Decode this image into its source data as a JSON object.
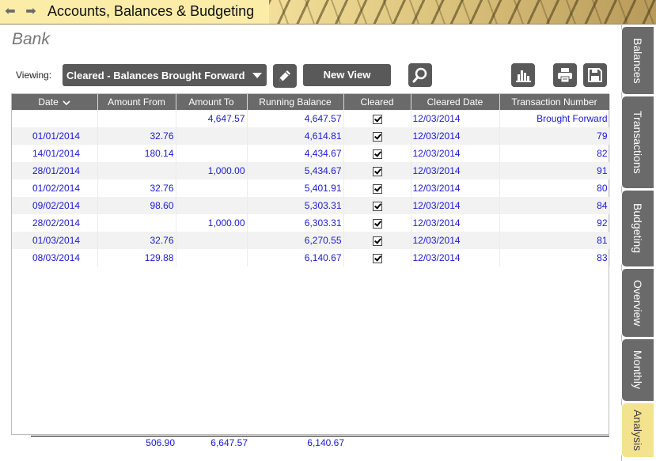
{
  "titlebar": {
    "title": "Accounts, Balances & Budgeting",
    "back_icon": "arrow-left-icon",
    "forward_icon": "arrow-right-icon"
  },
  "page": {
    "title": "Bank"
  },
  "toolbar": {
    "viewing_label": "Viewing:",
    "view_selected": "Cleared - Balances Brought Forward",
    "new_view_label": "New View"
  },
  "table": {
    "columns": [
      "Date",
      "Amount From",
      "Amount To",
      "Running Balance",
      "Cleared",
      "Cleared Date",
      "Transaction Number"
    ],
    "rows": [
      {
        "date": "",
        "from": "",
        "to": "4,647.57",
        "balance": "4,647.57",
        "cleared": true,
        "cleared_date": "12/03/2014",
        "txn": "Brought Forward"
      },
      {
        "date": "01/01/2014",
        "from": "32.76",
        "to": "",
        "balance": "4,614.81",
        "cleared": true,
        "cleared_date": "12/03/2014",
        "txn": "79"
      },
      {
        "date": "14/01/2014",
        "from": "180.14",
        "to": "",
        "balance": "4,434.67",
        "cleared": true,
        "cleared_date": "12/03/2014",
        "txn": "82"
      },
      {
        "date": "28/01/2014",
        "from": "",
        "to": "1,000.00",
        "balance": "5,434.67",
        "cleared": true,
        "cleared_date": "12/03/2014",
        "txn": "91"
      },
      {
        "date": "01/02/2014",
        "from": "32.76",
        "to": "",
        "balance": "5,401.91",
        "cleared": true,
        "cleared_date": "12/03/2014",
        "txn": "80"
      },
      {
        "date": "09/02/2014",
        "from": "98.60",
        "to": "",
        "balance": "5,303.31",
        "cleared": true,
        "cleared_date": "12/03/2014",
        "txn": "84"
      },
      {
        "date": "28/02/2014",
        "from": "",
        "to": "1,000.00",
        "balance": "6,303.31",
        "cleared": true,
        "cleared_date": "12/03/2014",
        "txn": "92"
      },
      {
        "date": "01/03/2014",
        "from": "32.76",
        "to": "",
        "balance": "6,270.55",
        "cleared": true,
        "cleared_date": "12/03/2014",
        "txn": "81"
      },
      {
        "date": "08/03/2014",
        "from": "129.88",
        "to": "",
        "balance": "6,140.67",
        "cleared": true,
        "cleared_date": "12/03/2014",
        "txn": "83"
      }
    ]
  },
  "totals": {
    "amount_from": "506.90",
    "amount_to": "6,647.57",
    "running_balance": "6,140.67"
  },
  "side_tabs": [
    {
      "label": "Balances",
      "active": false
    },
    {
      "label": "Transactions",
      "active": false
    },
    {
      "label": "Budgeting",
      "active": false
    },
    {
      "label": "Overview",
      "active": false
    },
    {
      "label": "Monthly",
      "active": false
    },
    {
      "label": "Analysis",
      "active": true
    }
  ],
  "colors": {
    "accent_yellow": "#f4e38e",
    "button_gray": "#595959",
    "header_gray": "#6a6a6a",
    "data_blue": "#1a1ad0"
  }
}
